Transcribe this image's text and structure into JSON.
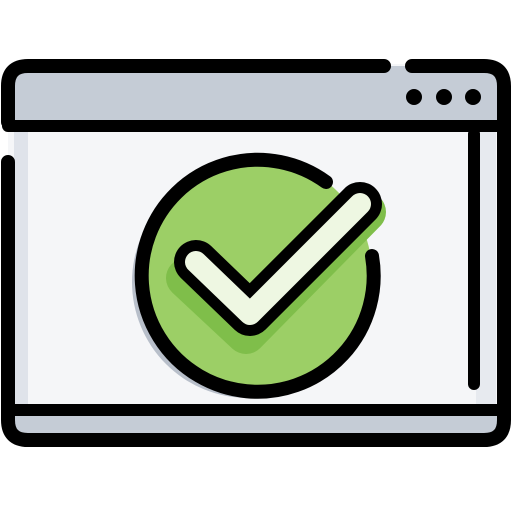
{
  "icon": {
    "name": "browser-window-checkmark-icon",
    "colors": {
      "outline": "#000000",
      "title_bar": "#c5ccd6",
      "window_body": "#f5f6f8",
      "window_edge_shadow": "#dfe3ea",
      "bottom_bar": "#c5ccd6",
      "badge_fill": "#9ccf66",
      "badge_shadow": "#b8bfca",
      "check_inner_shadow": "#7fbe4a",
      "check_fill": "#eef7e2"
    },
    "window_dots": 3
  }
}
